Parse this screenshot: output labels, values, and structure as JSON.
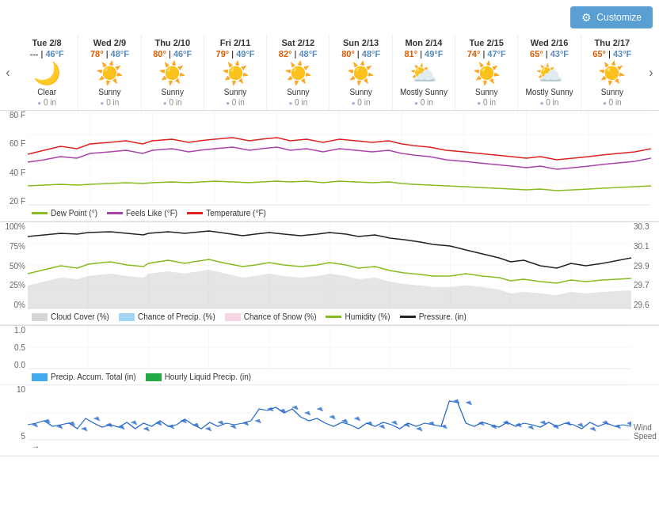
{
  "customize": {
    "label": "Customize",
    "icon": "⚙"
  },
  "days": [
    {
      "name": "Tue 2/8",
      "high": "---",
      "low": "46°F",
      "icon": "🌙",
      "desc": "Clear",
      "precip": "0 in"
    },
    {
      "name": "Wed 2/9",
      "high": "78°",
      "low": "48°F",
      "icon": "☀️",
      "desc": "Sunny",
      "precip": "0 in"
    },
    {
      "name": "Thu 2/10",
      "high": "80°",
      "low": "46°F",
      "icon": "☀️",
      "desc": "Sunny",
      "precip": "0 in"
    },
    {
      "name": "Fri 2/11",
      "high": "79°",
      "low": "49°F",
      "icon": "☀️",
      "desc": "Sunny",
      "precip": "0 in"
    },
    {
      "name": "Sat 2/12",
      "high": "82°",
      "low": "48°F",
      "icon": "☀️",
      "desc": "Sunny",
      "precip": "0 in"
    },
    {
      "name": "Sun 2/13",
      "high": "80°",
      "low": "48°F",
      "icon": "☀️",
      "desc": "Sunny",
      "precip": "0 in"
    },
    {
      "name": "Mon 2/14",
      "high": "81°",
      "low": "49°F",
      "icon": "⛅",
      "desc": "Mostly Sunny",
      "precip": "0 in"
    },
    {
      "name": "Tue 2/15",
      "high": "74°",
      "low": "47°F",
      "icon": "☀️",
      "desc": "Sunny",
      "precip": "0 in"
    },
    {
      "name": "Wed 2/16",
      "high": "65°",
      "low": "43°F",
      "icon": "⛅",
      "desc": "Mostly Sunny",
      "precip": "0 in"
    },
    {
      "name": "Thu 2/17",
      "high": "65°",
      "low": "43°F",
      "icon": "☀️",
      "desc": "Sunny",
      "precip": "0 in"
    }
  ],
  "temp_chart": {
    "y_labels": [
      "80 F",
      "60 F",
      "40 F",
      "20 F"
    ],
    "legend": [
      {
        "label": "Dew Point (°)",
        "color": "#88bb22",
        "type": "line"
      },
      {
        "label": "Feels Like (°F)",
        "color": "#aa44aa",
        "type": "line"
      },
      {
        "label": "Temperature (°F)",
        "color": "#dd2222",
        "type": "line"
      }
    ]
  },
  "humidity_chart": {
    "y_labels_left": [
      "100%",
      "75%",
      "50%",
      "25%",
      "0%"
    ],
    "y_labels_right": [
      "30.3",
      "30.1",
      "29.9",
      "29.7",
      "29.6"
    ],
    "legend": [
      {
        "label": "Cloud Cover (%)",
        "color": "#bbbbbb",
        "type": "fill"
      },
      {
        "label": "Chance of Precip. (%)",
        "color": "#66bbee",
        "type": "fill"
      },
      {
        "label": "Chance of Snow (%)",
        "color": "#eebbd4",
        "type": "fill"
      },
      {
        "label": "Humidity (%)",
        "color": "#88bb22",
        "type": "line"
      },
      {
        "label": "Pressure. (in)",
        "color": "#222222",
        "type": "line"
      }
    ]
  },
  "precip_chart": {
    "y_labels": [
      "1.0",
      "0.5",
      "0.0"
    ],
    "legend": [
      {
        "label": "Precip. Accum. Total (in)",
        "color": "#44aaee",
        "type": "fill"
      },
      {
        "label": "Hourly Liquid Precip. (in)",
        "color": "#22aa44",
        "type": "fill"
      }
    ]
  },
  "wind_chart": {
    "y_labels": [
      "10",
      "5"
    ],
    "legend_label": "Wind Speed",
    "legend_color": "#2266cc"
  }
}
